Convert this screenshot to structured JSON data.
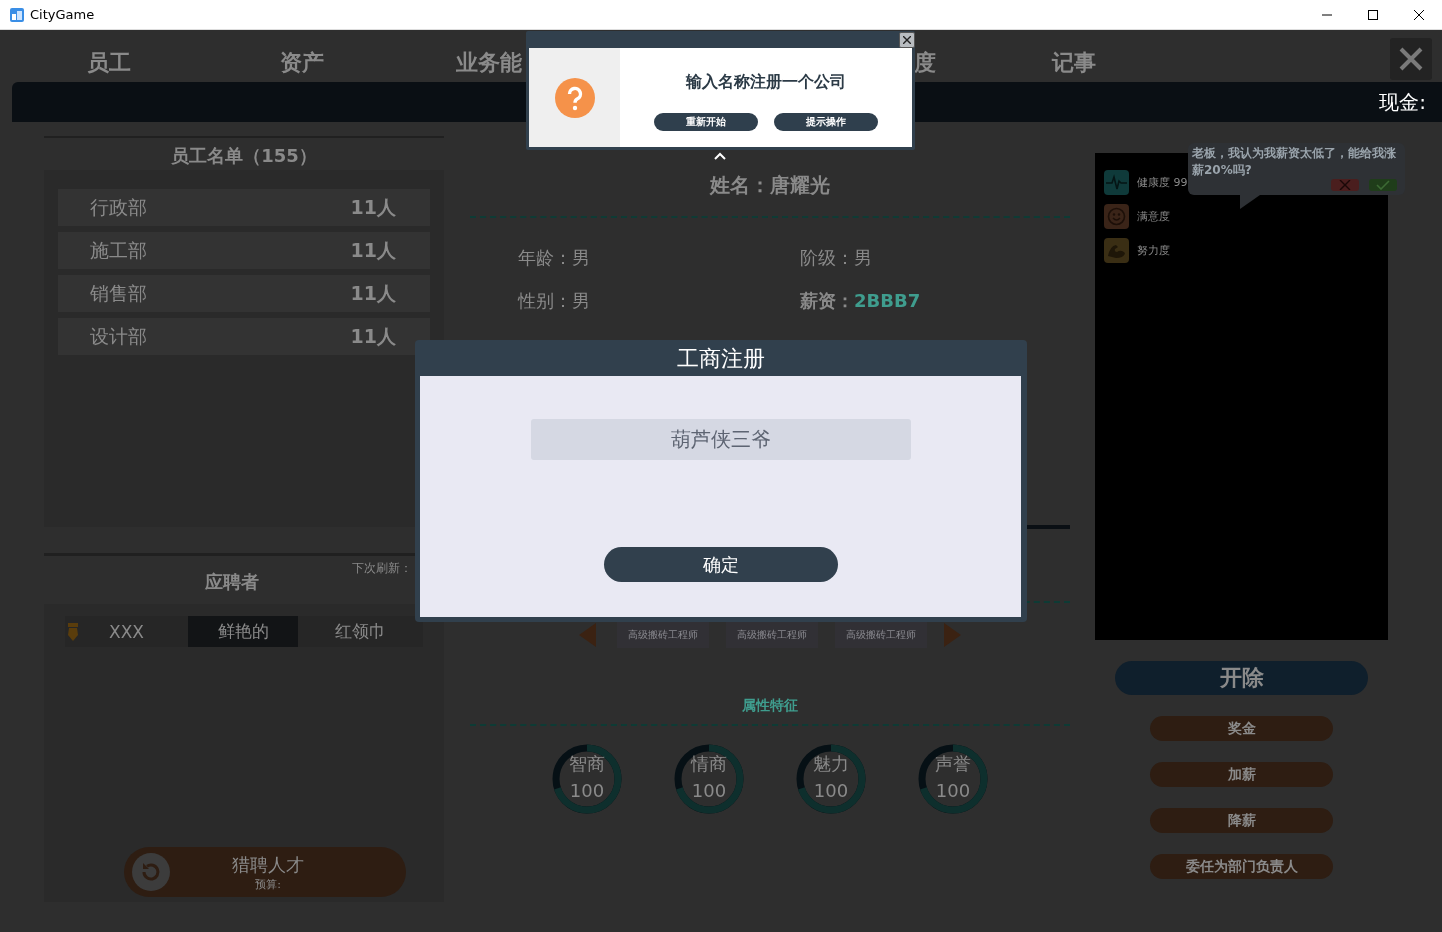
{
  "window": {
    "title": "CityGame"
  },
  "tabs": [
    {
      "label": "员工"
    },
    {
      "label": "资产"
    },
    {
      "label": "业务能"
    },
    {
      "label": "度"
    },
    {
      "label": "记事"
    }
  ],
  "cash_label": "现金:",
  "staff_list": {
    "title": "员工名单（155）",
    "departments": [
      {
        "name": "行政部",
        "count": "11人"
      },
      {
        "name": "施工部",
        "count": "11人"
      },
      {
        "name": "销售部",
        "count": "11人"
      },
      {
        "name": "设计部",
        "count": "11人"
      }
    ]
  },
  "applicants": {
    "title": "应聘者",
    "refresh": "下次刷新：",
    "cells": [
      {
        "text": "XXX",
        "selected": false
      },
      {
        "text": "鲜艳的",
        "selected": true
      },
      {
        "text": "红领巾",
        "selected": false
      }
    ],
    "hunt_button": {
      "label": "猎聘人才",
      "budget": "预算:"
    }
  },
  "employee": {
    "name": "姓名：唐耀光",
    "fields": [
      {
        "label": "年龄：",
        "value": "男",
        "kind": "plain"
      },
      {
        "label": "阶级：",
        "value": "男",
        "kind": "plain"
      },
      {
        "label": "性别：",
        "value": "男",
        "kind": "plain"
      },
      {
        "label": "薪资：",
        "value": "2BBB7",
        "kind": "salary"
      }
    ],
    "titles": [
      "高级搬砖工程师",
      "高级搬砖工程师",
      "高级搬砖工程师"
    ],
    "traits_title": "属性特征",
    "traits": [
      {
        "name": "智商",
        "value": "100",
        "level": 0.7
      },
      {
        "name": "情商",
        "value": "100",
        "level": 0.7
      },
      {
        "name": "魅力",
        "value": "100",
        "level": 0.7
      },
      {
        "name": "声誉",
        "value": "100",
        "level": 0.7
      }
    ]
  },
  "status": {
    "stats": [
      {
        "kind": "health",
        "label": "健康度 99"
      },
      {
        "kind": "mood",
        "label": "满意度"
      },
      {
        "kind": "effort",
        "label": "努力度"
      }
    ],
    "request": "老板，我认为我薪资太低了，能给我涨薪20%吗?"
  },
  "actions": [
    {
      "label": "开除",
      "kind": "primary"
    },
    {
      "label": "奖金",
      "kind": "secondary"
    },
    {
      "label": "加薪",
      "kind": "secondary"
    },
    {
      "label": "降薪",
      "kind": "secondary"
    },
    {
      "label": "委任为部门负责人",
      "kind": "secondary"
    }
  ],
  "hint_popup": {
    "message": "输入名称注册一个公司",
    "buttons": [
      "重新开始",
      "提示操作"
    ]
  },
  "register_dialog": {
    "title": "工商注册",
    "company_name": "葫芦侠三爷",
    "confirm": "确定"
  }
}
